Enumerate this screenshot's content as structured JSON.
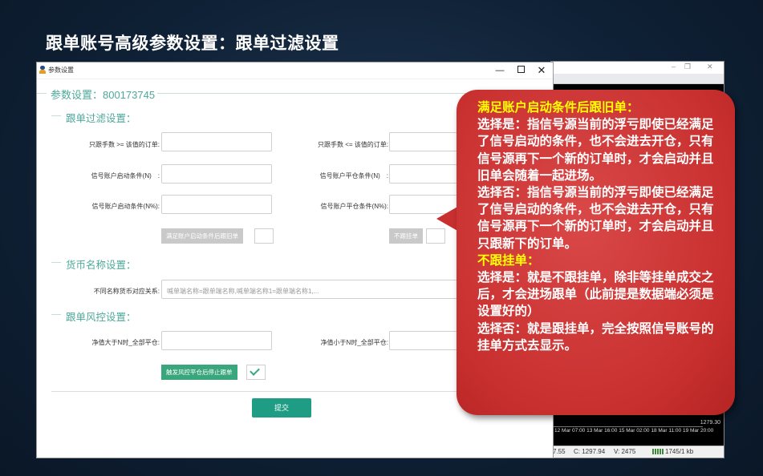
{
  "slide": {
    "title": "跟单账号高级参数设置：跟单过滤设置"
  },
  "dialog": {
    "title": "参数设置",
    "min_glyph": "—",
    "close_glyph": "✕",
    "account_legend": "参数设置：800173745",
    "sections": {
      "filter": {
        "legend": "跟单过滤设置：",
        "lot_min_label": "只跟手数 >= 该值的订单:",
        "lot_max_label": "只跟手数 <= 该值的订单:",
        "start_cond_label": "信号账户启动条件(N)　:",
        "close_cond_label": "信号账户平仓条件(N)　:",
        "start_cond_pct_label": "信号账户启动条件(N%):",
        "close_cond_pct_label": "信号账户平仓条件(N%):",
        "follow_old_toggle": "满足账户启动条件后跟旧单",
        "no_pending_toggle": "不跟挂单"
      },
      "currency": {
        "legend": "货币名称设置：",
        "mapping_label": "不同名称货币对应关系:",
        "mapping_placeholder": "喊单端名称=跟单端名称,喊单端名称1=跟单端名称1,..."
      },
      "risk": {
        "legend": "跟单风控设置：",
        "equity_above_label": "净值大于N时_全部平仓:",
        "equity_below_label": "净值小于N时_全部平仓:",
        "stop_toggle": "触发风控平仓后停止跟单"
      }
    },
    "submit_label": "提交"
  },
  "background_window": {
    "price": "1279.30",
    "times": "12 Mar 07:00   13 Mar 16:00   15 Mar 02:00   18 Mar 11:00   19 Mar 20:00",
    "status": {
      "left": "7.55",
      "close": "C: 1297.94",
      "volume": "V: 2475",
      "traffic": "1745/1 kb"
    }
  },
  "callout": {
    "h1": "满足账户启动条件后跟旧单：",
    "p1": "选择是：指信号源当前的浮亏即使已经满足了信号启动的条件，也不会进去开仓，只有信号源再下一个新的订单时，才会启动并且旧单会随着一起进场。",
    "p2": "选择否：指信号源当前的浮亏即使已经满足了信号启动的条件，也不会进去开仓，只有信号源再下一个新的订单时，才会启动并且只跟新下的订单。",
    "h2": "不跟挂单：",
    "p3": "选择是：就是不跟挂单，除非等挂单成交之后，才会进场跟单（此前提是数据端必须是设置好的）",
    "p4": "选择否：就是跟挂单，完全按照信号账号的挂单方式去显示。"
  }
}
